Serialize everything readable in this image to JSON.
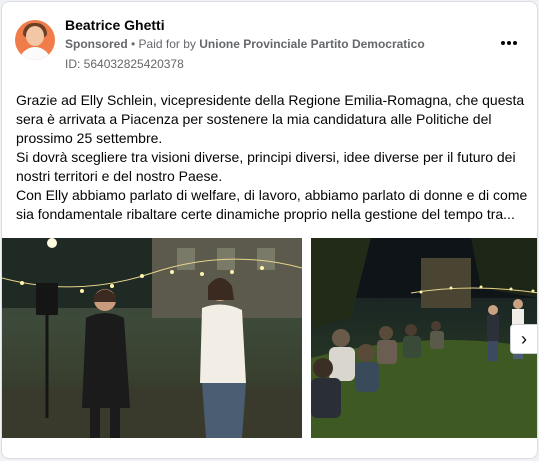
{
  "post": {
    "author": "Beatrice Ghetti",
    "sponsored": "Sponsored",
    "separator": " • ",
    "paid_for_prefix": "Paid for by ",
    "advertiser": "Unione Provinciale Partito Democratico",
    "ad_id": "ID: 564032825420378",
    "more_icon": "more-options-icon",
    "paragraphs": [
      "Grazie ad Elly Schlein, vicepresidente della Regione Emilia-Romagna, che questa sera è arrivata a Piacenza per sostenere la mia candidatura alle Politiche del prossimo 25 settembre.",
      "Si dovrà scegliere tra visioni diverse, principi diversi, idee diverse per il futuro dei nostri territori e del nostro Paese.",
      "Con Elly abbiamo parlato di welfare, di lavoro, abbiamo parlato di donne e di come sia fondamentale ribaltare certe dinamiche proprio nella gestione del tempo tra..."
    ]
  },
  "carousel": {
    "next_icon": "chevron-right-icon",
    "next_glyph": "›"
  },
  "colors": {
    "text_primary": "#050505",
    "text_secondary": "#65676b",
    "card_border": "#dadde1"
  }
}
